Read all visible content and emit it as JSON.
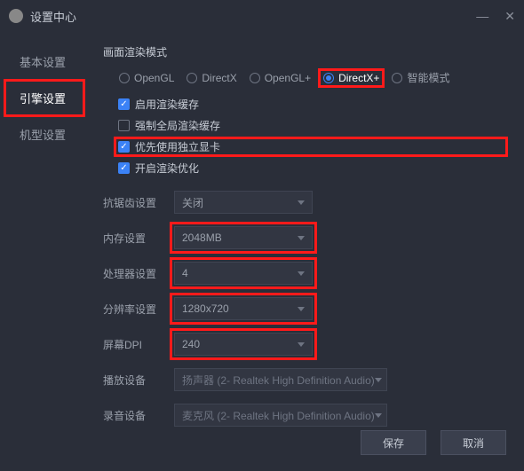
{
  "titlebar": {
    "title": "设置中心"
  },
  "sidebar": {
    "items": [
      {
        "label": "基本设置",
        "active": false,
        "hl": false
      },
      {
        "label": "引擎设置",
        "active": true,
        "hl": true
      },
      {
        "label": "机型设置",
        "active": false,
        "hl": false
      }
    ]
  },
  "render": {
    "section_label": "画面渲染模式",
    "options": [
      "OpenGL",
      "DirectX",
      "OpenGL+",
      "DirectX+",
      "智能模式"
    ],
    "selected": "DirectX+",
    "checks": [
      {
        "label": "启用渲染缓存",
        "on": true,
        "hl": false
      },
      {
        "label": "强制全局渲染缓存",
        "on": false,
        "hl": false
      },
      {
        "label": "优先使用独立显卡",
        "on": true,
        "hl": true
      },
      {
        "label": "开启渲染优化",
        "on": true,
        "hl": false
      }
    ]
  },
  "fields": {
    "aa": {
      "label": "抗锯齿设置",
      "value": "关闭",
      "hl": false
    },
    "memory": {
      "label": "内存设置",
      "value": "2048MB",
      "hl": true
    },
    "cpu": {
      "label": "处理器设置",
      "value": "4",
      "hl": true
    },
    "res": {
      "label": "分辨率设置",
      "value": "1280x720",
      "hl": true
    },
    "dpi": {
      "label": "屏幕DPI",
      "value": "240",
      "hl": true
    },
    "playback": {
      "label": "播放设备",
      "value": "扬声器 (2- Realtek High Definition Audio)"
    },
    "record": {
      "label": "录音设备",
      "value": "麦克风 (2- Realtek High Definition Audio)"
    }
  },
  "buttons": {
    "save": "保存",
    "cancel": "取消"
  }
}
